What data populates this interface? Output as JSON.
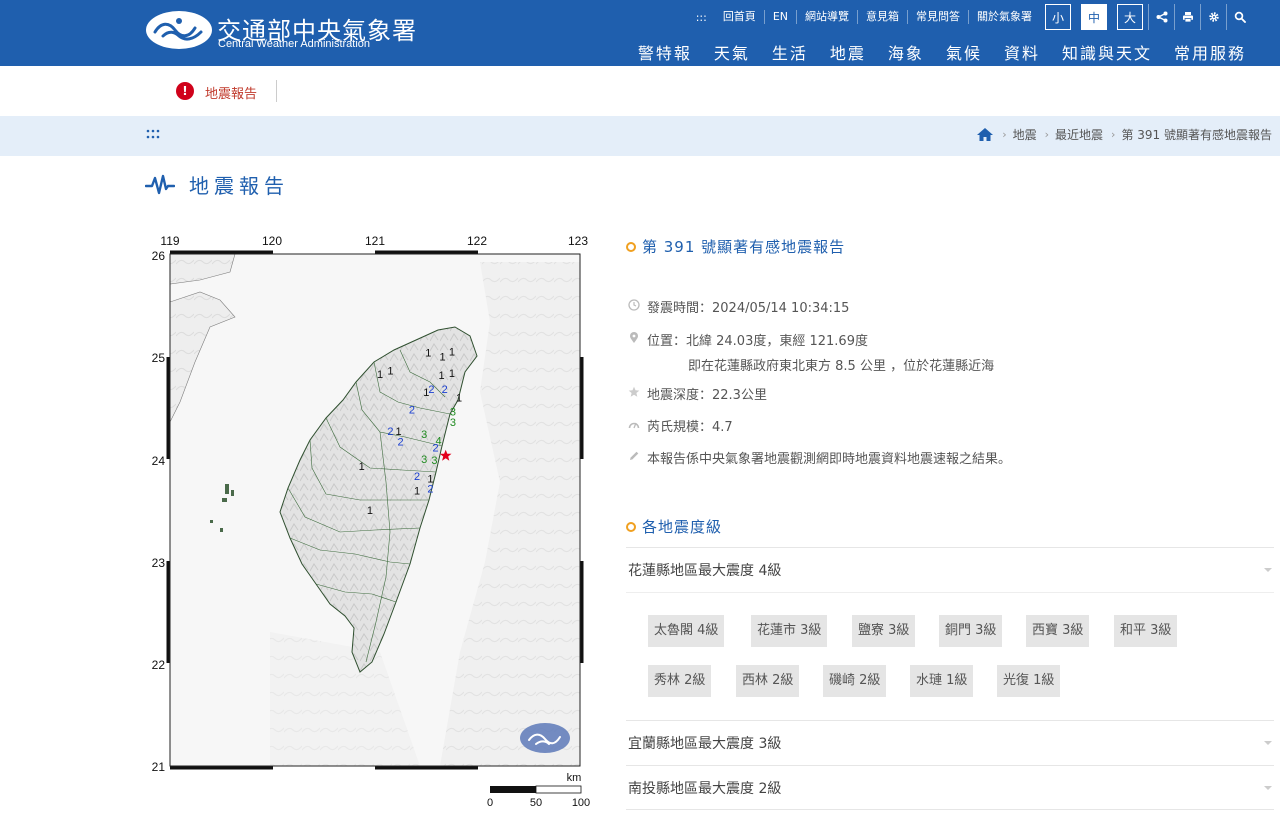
{
  "header": {
    "logo_zh": "交通部中央氣象署",
    "logo_en": "Central Weather Administration",
    "top_links": [
      "回首頁",
      "EN",
      "網站導覽",
      "意見箱",
      "常見問答",
      "關於氣象署"
    ],
    "font_sizes": [
      "小",
      "中",
      "大"
    ],
    "active_font_size": "中",
    "tool_icons": [
      "share-icon",
      "print-icon",
      "gear-icon",
      "search-icon"
    ],
    "main_nav": [
      "警特報",
      "天氣",
      "生活",
      "地震",
      "海象",
      "氣候",
      "資料",
      "知識與天文",
      "常用服務"
    ]
  },
  "alert": {
    "icon": "!",
    "text": "地震報告"
  },
  "breadcrumb": {
    "items": [
      "地震",
      "最近地震",
      "第 391 號顯著有感地震報告"
    ]
  },
  "page_title": "地震報告",
  "map": {
    "x_ticks": [
      "119",
      "120",
      "121",
      "122",
      "123"
    ],
    "y_ticks": [
      "26",
      "25",
      "24",
      "23",
      "22",
      "21"
    ],
    "scale_unit": "km",
    "scale_labels": [
      "0",
      "50",
      "100"
    ],
    "epicenter": {
      "lon": 121.69,
      "lat": 24.03
    },
    "intensity_labels": [
      {
        "v": "1",
        "lon": 121.52,
        "lat": 25.04,
        "c": "#111"
      },
      {
        "v": "1",
        "lon": 121.66,
        "lat": 25.0,
        "c": "#111"
      },
      {
        "v": "1",
        "lon": 121.75,
        "lat": 25.05,
        "c": "#111"
      },
      {
        "v": "1",
        "lon": 121.05,
        "lat": 24.83,
        "c": "#111"
      },
      {
        "v": "1",
        "lon": 121.15,
        "lat": 24.86,
        "c": "#111"
      },
      {
        "v": "1",
        "lon": 121.65,
        "lat": 24.82,
        "c": "#111"
      },
      {
        "v": "1",
        "lon": 121.75,
        "lat": 24.84,
        "c": "#111"
      },
      {
        "v": "1",
        "lon": 121.5,
        "lat": 24.65,
        "c": "#111"
      },
      {
        "v": "1",
        "lon": 121.82,
        "lat": 24.6,
        "c": "#111"
      },
      {
        "v": "2",
        "lon": 121.55,
        "lat": 24.68,
        "c": "#1a3fd0"
      },
      {
        "v": "2",
        "lon": 121.68,
        "lat": 24.68,
        "c": "#1a3fd0"
      },
      {
        "v": "2",
        "lon": 121.36,
        "lat": 24.48,
        "c": "#1a3fd0"
      },
      {
        "v": "3",
        "lon": 121.76,
        "lat": 24.46,
        "c": "#1e8a1e"
      },
      {
        "v": "3",
        "lon": 121.76,
        "lat": 24.36,
        "c": "#1e8a1e"
      },
      {
        "v": "2",
        "lon": 121.15,
        "lat": 24.27,
        "c": "#1a3fd0"
      },
      {
        "v": "1",
        "lon": 121.23,
        "lat": 24.27,
        "c": "#111"
      },
      {
        "v": "2",
        "lon": 121.25,
        "lat": 24.17,
        "c": "#1a3fd0"
      },
      {
        "v": "3",
        "lon": 121.48,
        "lat": 24.24,
        "c": "#1e8a1e"
      },
      {
        "v": "4",
        "lon": 121.62,
        "lat": 24.18,
        "c": "#1e8a1e"
      },
      {
        "v": "2",
        "lon": 121.59,
        "lat": 24.11,
        "c": "#1a3fd0"
      },
      {
        "v": "3",
        "lon": 121.48,
        "lat": 24.0,
        "c": "#1e8a1e"
      },
      {
        "v": "3",
        "lon": 121.58,
        "lat": 23.99,
        "c": "#1e8a1e"
      },
      {
        "v": "1",
        "lon": 120.87,
        "lat": 23.93,
        "c": "#111"
      },
      {
        "v": "2",
        "lon": 121.41,
        "lat": 23.83,
        "c": "#1a3fd0"
      },
      {
        "v": "1",
        "lon": 121.54,
        "lat": 23.81,
        "c": "#111"
      },
      {
        "v": "1",
        "lon": 121.41,
        "lat": 23.69,
        "c": "#111"
      },
      {
        "v": "2",
        "lon": 121.54,
        "lat": 23.71,
        "c": "#1a3fd0"
      },
      {
        "v": "1",
        "lon": 120.95,
        "lat": 23.5,
        "c": "#111"
      }
    ]
  },
  "report": {
    "title": "第 391 號顯著有感地震報告",
    "time": "發震時間：2024/05/14 10:34:15",
    "location": "位置：北緯 24.03度，東經 121.69度",
    "location_detail": "即在花蓮縣政府東北東方 8.5 公里 ，位於花蓮縣近海",
    "depth": "地震深度：22.3公里",
    "magnitude": "芮氏規模：4.7",
    "note": "本報告係中央氣象署地震觀測網即時地震資料地震速報之結果。"
  },
  "intensity": {
    "section_title": "各地震度級",
    "regions": [
      {
        "title": "花蓮縣地區最大震度 4級",
        "stations": [
          "太魯閣 4級",
          "花蓮市 3級",
          "鹽寮 3級",
          "銅門 3級",
          "西寶 3級",
          "和平 3級",
          "秀林 2級",
          "西林 2級",
          "磯崎 2級",
          "水璉 1級",
          "光復 1級"
        ]
      },
      {
        "title": "宜蘭縣地區最大震度 3級"
      },
      {
        "title": "南投縣地區最大震度 2級"
      }
    ]
  }
}
